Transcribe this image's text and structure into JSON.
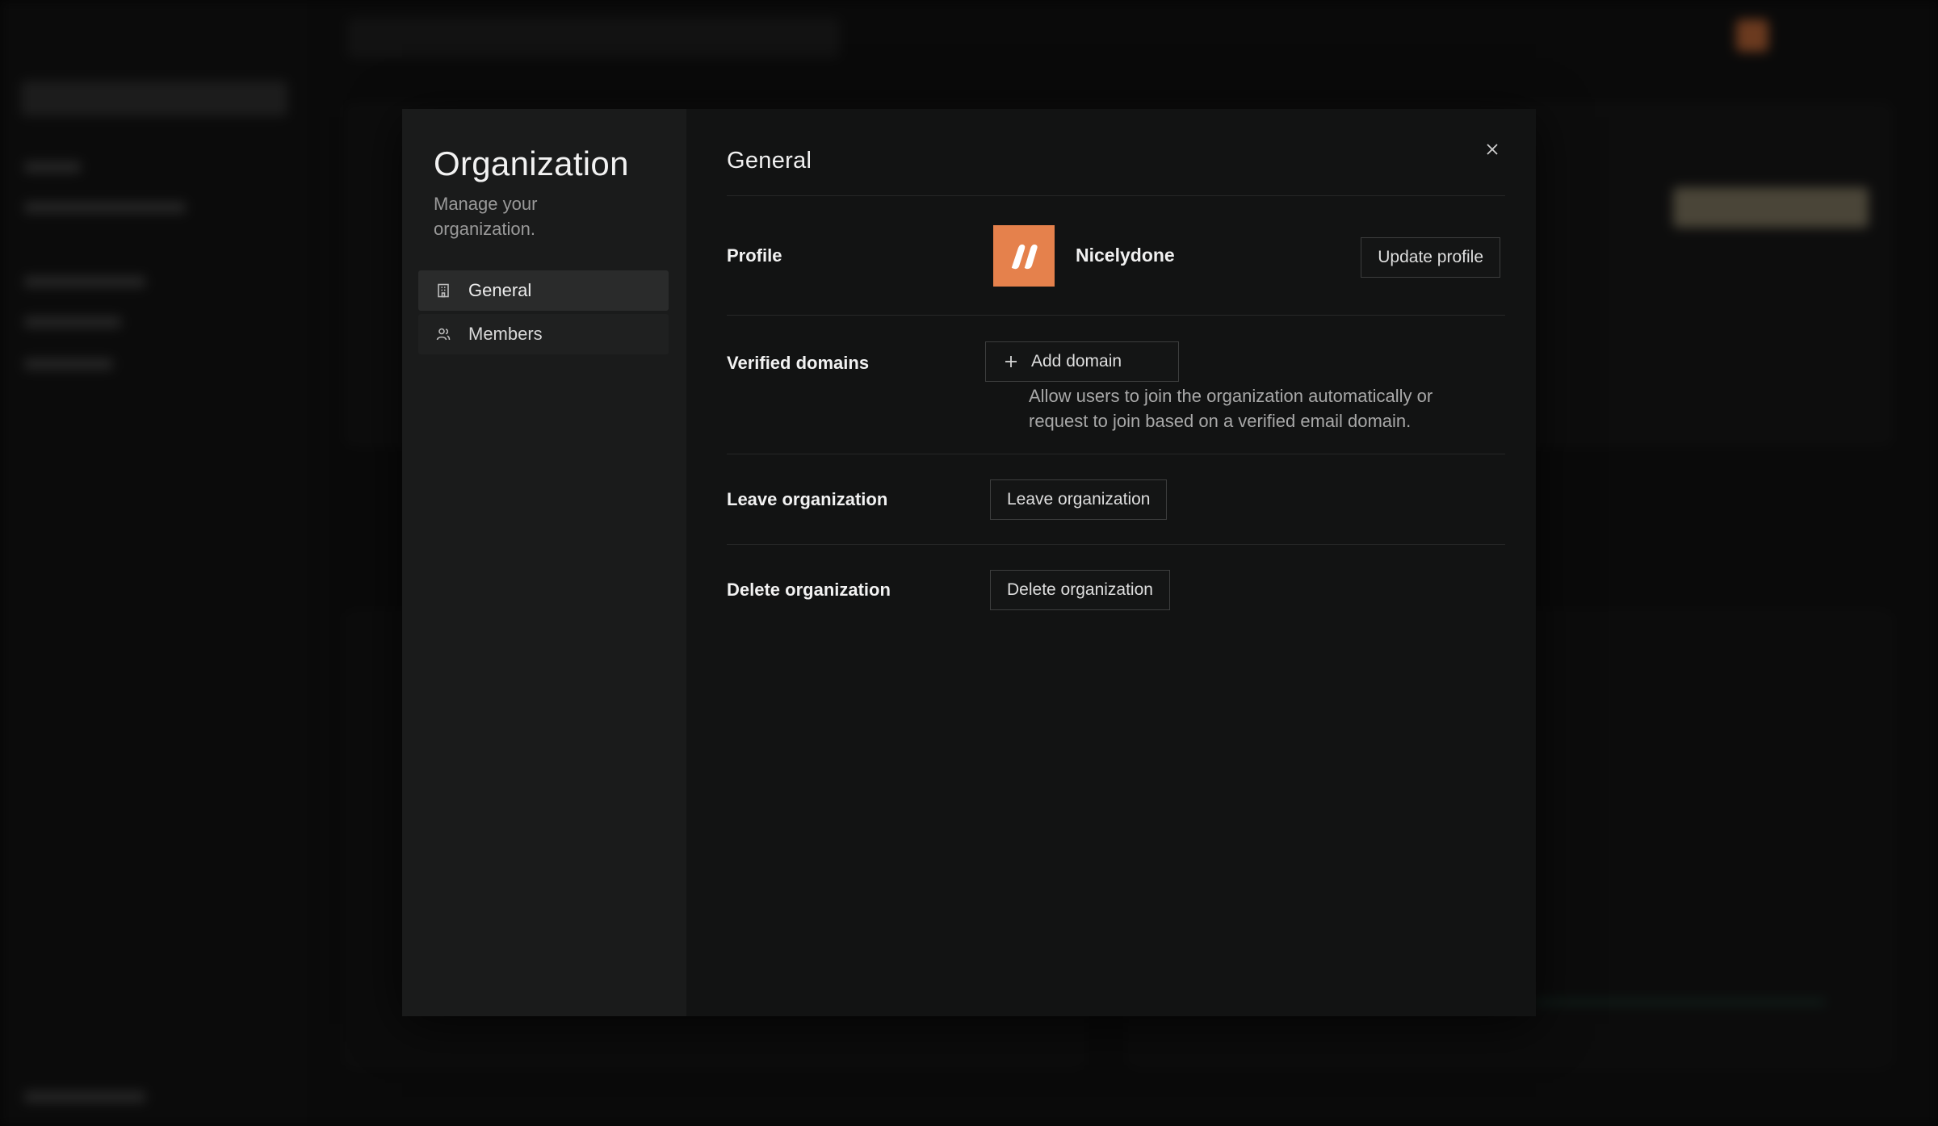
{
  "modal": {
    "title": "Organization",
    "subtitle": "Manage your organization.",
    "nav": [
      {
        "label": "General",
        "icon": "building-icon",
        "active": true
      },
      {
        "label": "Members",
        "icon": "users-icon",
        "active": false
      }
    ]
  },
  "general": {
    "title": "General",
    "profile": {
      "label": "Profile",
      "org_name": "Nicelydone",
      "logo_color": "#e5814c",
      "update_label": "Update profile"
    },
    "domains": {
      "label": "Verified domains",
      "add_label": "Add domain",
      "help": "Allow users to join the organization automatically or request to join based on a verified email domain."
    },
    "leave": {
      "label": "Leave organization",
      "button_label": "Leave organization"
    },
    "delete": {
      "label": "Delete organization",
      "button_label": "Delete organization"
    }
  }
}
